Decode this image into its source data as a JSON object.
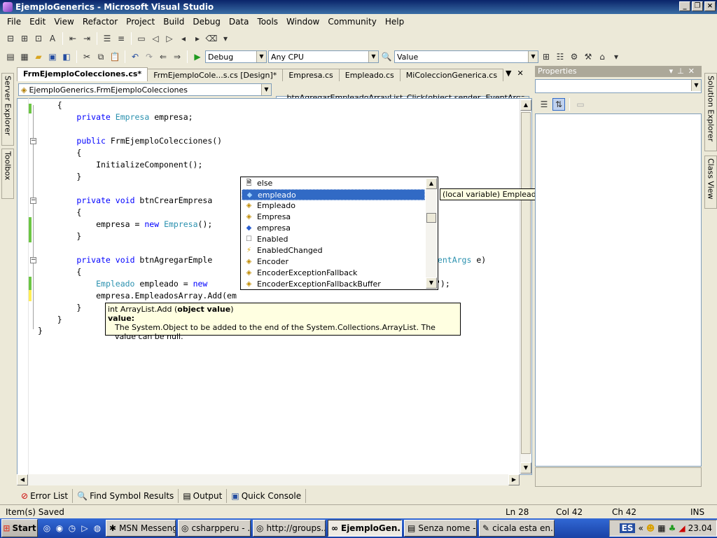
{
  "window": {
    "title": "EjemploGenerics - Microsoft Visual Studio"
  },
  "menu": [
    "File",
    "Edit",
    "View",
    "Refactor",
    "Project",
    "Build",
    "Debug",
    "Data",
    "Tools",
    "Window",
    "Community",
    "Help"
  ],
  "toolbar2": {
    "config": "Debug",
    "platform": "Any CPU",
    "find": "Value"
  },
  "side_left": {
    "server_explorer": "Server Explorer",
    "toolbox": "Toolbox"
  },
  "side_right": {
    "solution_explorer": "Solution Explorer",
    "class_view": "Class View"
  },
  "doc_tabs": [
    {
      "label": "FrmEjemploColecciones.cs*",
      "active": true
    },
    {
      "label": "FrmEjemploCole...s.cs [Design]*",
      "active": false
    },
    {
      "label": "Empresa.cs",
      "active": false
    },
    {
      "label": "Empleado.cs",
      "active": false
    },
    {
      "label": "MiColeccionGenerica.cs",
      "active": false
    }
  ],
  "nav": {
    "type_combo": "EjemploGenerics.FrmEjemploColecciones",
    "member_combo": "btnAgregarEmpleadoArrayList_Click(object sender, EventArgs e)"
  },
  "code_lines": [
    "    {",
    "        private Empresa empresa;",
    "",
    "        public FrmEjemploColecciones()",
    "        {",
    "            InitializeComponent();",
    "        }",
    "",
    "        private void btnCrearEmpresa",
    "        {",
    "            empresa = new Empresa();",
    "        }",
    "",
    "        private void btnAgregarEmple",
    "        {",
    "            Empleado empleado = new",
    "            empresa.EmpleadosArray.Add(em",
    "        }",
    "    }",
    "}"
  ],
  "code_fragments": {
    "eventargs": "ventArgs e)",
    "close_call": "\");"
  },
  "intellisense": {
    "items": [
      {
        "label": "else",
        "icon": "snippet-icon",
        "selected": false
      },
      {
        "label": "empleado",
        "icon": "local-variable-icon",
        "selected": true
      },
      {
        "label": "Empleado",
        "icon": "class-icon",
        "selected": false
      },
      {
        "label": "Empresa",
        "icon": "class-icon",
        "selected": false
      },
      {
        "label": "empresa",
        "icon": "field-icon",
        "selected": false
      },
      {
        "label": "Enabled",
        "icon": "property-icon",
        "selected": false
      },
      {
        "label": "EnabledChanged",
        "icon": "event-icon",
        "selected": false
      },
      {
        "label": "Encoder",
        "icon": "class-icon",
        "selected": false
      },
      {
        "label": "EncoderExceptionFallback",
        "icon": "class-icon",
        "selected": false
      },
      {
        "label": "EncoderExceptionFallbackBuffer",
        "icon": "class-icon",
        "selected": false
      }
    ],
    "quickinfo": "(local variable) Empleado empleado"
  },
  "paraminfo": {
    "signature_prefix": "int ArrayList.Add (",
    "signature_param": "object value",
    "signature_suffix": ")",
    "param_name": "value:",
    "param_desc": "The System.Object to be added to the end of the System.Collections.ArrayList. The value can be null."
  },
  "properties": {
    "title": "Properties"
  },
  "bottom_tabs": [
    "Error List",
    "Find Symbol Results",
    "Output",
    "Quick Console"
  ],
  "status": {
    "message": "Item(s) Saved",
    "ln": "Ln 28",
    "col": "Col 42",
    "ch": "Ch 42",
    "mode": "INS"
  },
  "taskbar": {
    "start": "Start",
    "buttons": [
      {
        "label": "MSN Messenger",
        "active": false
      },
      {
        "label": "csharpperu - ...",
        "active": false
      },
      {
        "label": "http://groups....",
        "active": false
      },
      {
        "label": "EjemploGen...",
        "active": true
      },
      {
        "label": "Senza nome -...",
        "active": false
      },
      {
        "label": "cicala esta en...",
        "active": false
      }
    ],
    "lang": "ES",
    "clock": "23.04"
  },
  "colors": {
    "keyword": "#0000ff",
    "type": "#2b91af",
    "selection": "#316ac5",
    "tooltip": "#ffffe1"
  }
}
